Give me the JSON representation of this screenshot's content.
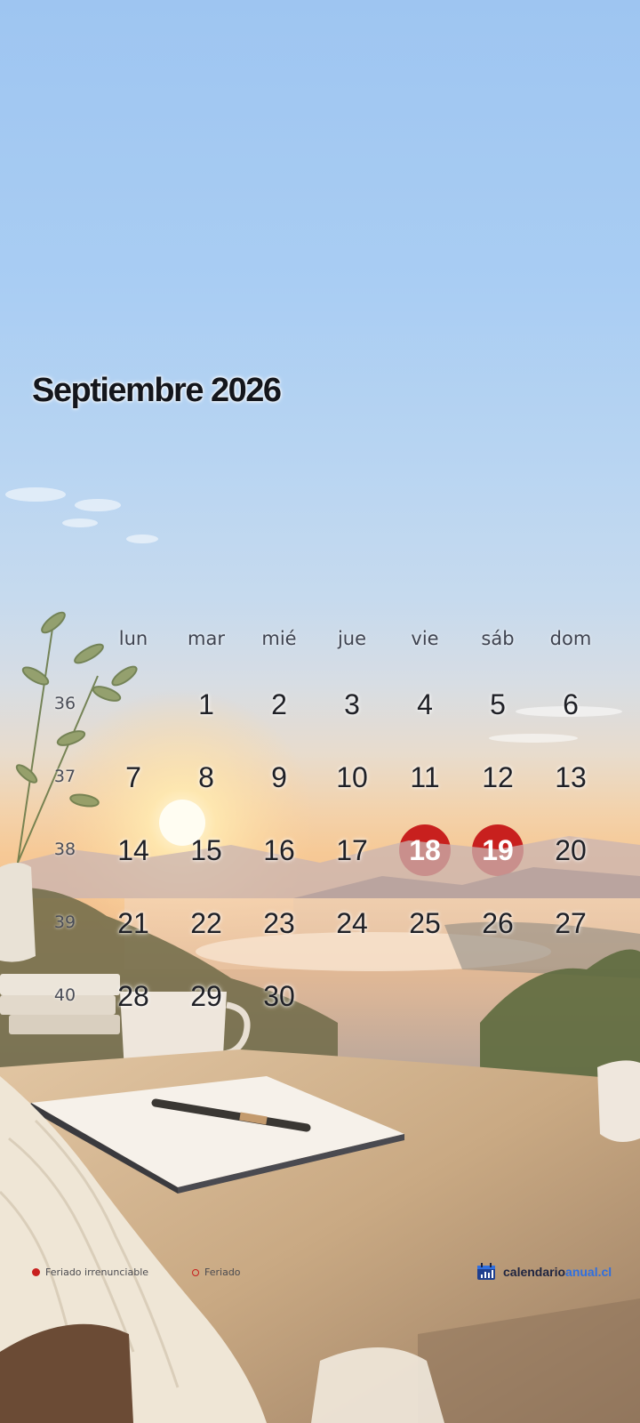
{
  "calendar": {
    "title": "Septiembre 2026",
    "weekday_headers": [
      "lun",
      "mar",
      "mié",
      "jue",
      "vie",
      "sáb",
      "dom"
    ],
    "weeks": [
      {
        "number": "36",
        "days": [
          "",
          "1",
          "2",
          "3",
          "4",
          "5",
          "6"
        ]
      },
      {
        "number": "37",
        "days": [
          "7",
          "8",
          "9",
          "10",
          "11",
          "12",
          "13"
        ]
      },
      {
        "number": "38",
        "days": [
          "14",
          "15",
          "16",
          "17",
          "18",
          "19",
          "20"
        ]
      },
      {
        "number": "39",
        "days": [
          "21",
          "22",
          "23",
          "24",
          "25",
          "26",
          "27"
        ]
      },
      {
        "number": "40",
        "days": [
          "28",
          "29",
          "30",
          "",
          "",
          "",
          ""
        ]
      }
    ],
    "irrenunciable_holidays": [
      "18",
      "19"
    ],
    "holiday_color": "#c8201e"
  },
  "legend": {
    "irrenunciable_label": "Feriado irrenunciable",
    "holiday_label": "Feriado"
  },
  "brand": {
    "name_dark": "calendario",
    "name_accent": "anual.cl",
    "icon": "calendar-chart-icon",
    "accent_color": "#2f6fe0"
  }
}
